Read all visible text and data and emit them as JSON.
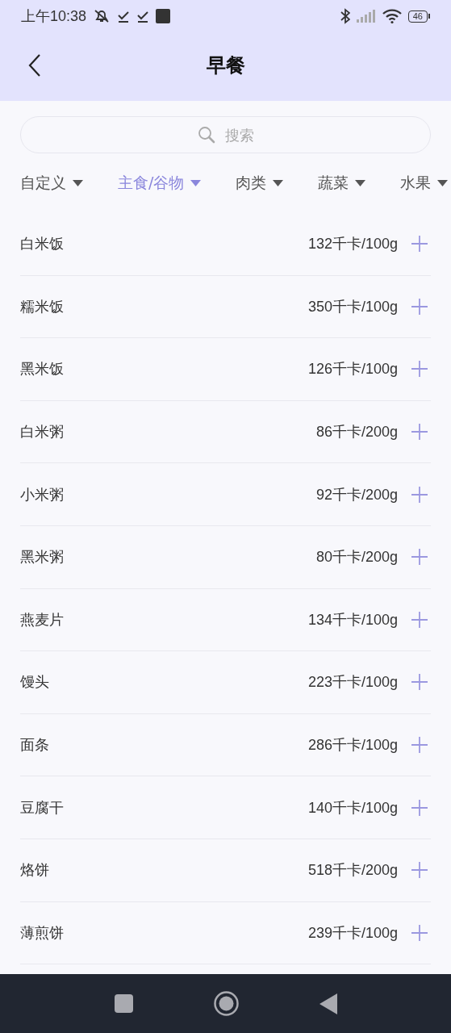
{
  "status_bar": {
    "time": "上午10:38",
    "battery": "46"
  },
  "header": {
    "title": "早餐"
  },
  "search": {
    "placeholder": "搜索"
  },
  "categories": [
    {
      "label": "自定义",
      "selected": false
    },
    {
      "label": "主食/谷物",
      "selected": true
    },
    {
      "label": "肉类",
      "selected": false
    },
    {
      "label": "蔬菜",
      "selected": false
    },
    {
      "label": "水果",
      "selected": false
    }
  ],
  "foods": [
    {
      "name": "白米饭",
      "calories": "132千卡/100g"
    },
    {
      "name": "糯米饭",
      "calories": "350千卡/100g"
    },
    {
      "name": "黑米饭",
      "calories": "126千卡/100g"
    },
    {
      "name": "白米粥",
      "calories": "86千卡/200g"
    },
    {
      "name": "小米粥",
      "calories": "92千卡/200g"
    },
    {
      "name": "黑米粥",
      "calories": "80千卡/200g"
    },
    {
      "name": "燕麦片",
      "calories": "134千卡/100g"
    },
    {
      "name": "馒头",
      "calories": "223千卡/100g"
    },
    {
      "name": "面条",
      "calories": "286千卡/100g"
    },
    {
      "name": "豆腐干",
      "calories": "140千卡/100g"
    },
    {
      "name": "烙饼",
      "calories": "518千卡/200g"
    },
    {
      "name": "薄煎饼",
      "calories": "239千卡/100g"
    }
  ]
}
